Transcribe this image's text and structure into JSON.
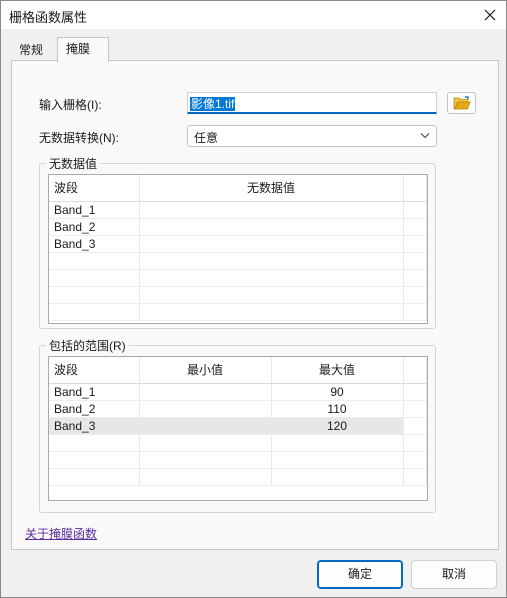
{
  "window": {
    "title": "栅格函数属性"
  },
  "tabs": [
    {
      "label": "常规"
    },
    {
      "label": "掩膜"
    }
  ],
  "form": {
    "input_raster_label": "输入栅格(I):",
    "input_raster_value": "影像1.tif",
    "nodata_mapping_label": "无数据转换(N):",
    "nodata_mapping_value": "任意"
  },
  "nodata_group": {
    "title": "无数据值",
    "columns": [
      "波段",
      "无数据值"
    ],
    "rows": [
      {
        "band": "Band_1",
        "nodata": ""
      },
      {
        "band": "Band_2",
        "nodata": ""
      },
      {
        "band": "Band_3",
        "nodata": ""
      }
    ]
  },
  "range_group": {
    "title": "包括的范围(R)",
    "columns": [
      "波段",
      "最小值",
      "最大值"
    ],
    "rows": [
      {
        "band": "Band_1",
        "min": "",
        "max": "90"
      },
      {
        "band": "Band_2",
        "min": "",
        "max": "110"
      },
      {
        "band": "Band_3",
        "min": "",
        "max": "120"
      }
    ]
  },
  "about_link": "关于掩膜函数",
  "buttons": {
    "ok": "确定",
    "cancel": "取消"
  },
  "icons": {
    "close": "close-icon",
    "folder": "open-folder-icon",
    "dropdown": "chevron-down-icon"
  },
  "colors": {
    "accent": "#0067c0",
    "selection": "#0078d7",
    "link": "#5a2b9e",
    "folder": "#e6a817"
  }
}
